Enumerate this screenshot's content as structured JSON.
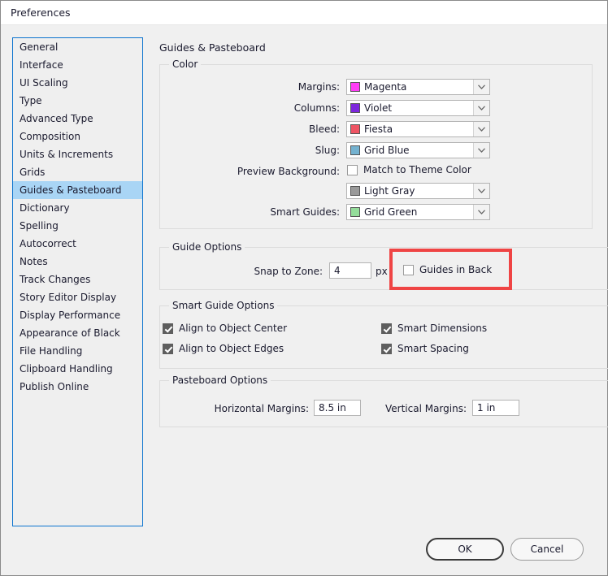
{
  "window": {
    "title": "Preferences"
  },
  "sidebar": {
    "selected": "Guides & Pasteboard",
    "items": [
      {
        "label": "General"
      },
      {
        "label": "Interface"
      },
      {
        "label": "UI Scaling"
      },
      {
        "label": "Type"
      },
      {
        "label": "Advanced Type"
      },
      {
        "label": "Composition"
      },
      {
        "label": "Units & Increments"
      },
      {
        "label": "Grids"
      },
      {
        "label": "Guides & Pasteboard"
      },
      {
        "label": "Dictionary"
      },
      {
        "label": "Spelling"
      },
      {
        "label": "Autocorrect"
      },
      {
        "label": "Notes"
      },
      {
        "label": "Track Changes"
      },
      {
        "label": "Story Editor Display"
      },
      {
        "label": "Display Performance"
      },
      {
        "label": "Appearance of Black"
      },
      {
        "label": "File Handling"
      },
      {
        "label": "Clipboard Handling"
      },
      {
        "label": "Publish Online"
      }
    ]
  },
  "pane": {
    "title": "Guides & Pasteboard"
  },
  "color_group": {
    "legend": "Color",
    "rows": [
      {
        "label": "Margins:",
        "value": "Magenta",
        "swatch": "#ff3df5"
      },
      {
        "label": "Columns:",
        "value": "Violet",
        "swatch": "#7d28dd"
      },
      {
        "label": "Bleed:",
        "value": "Fiesta",
        "swatch": "#ef5564"
      },
      {
        "label": "Slug:",
        "value": "Grid Blue",
        "swatch": "#74b2d0"
      }
    ],
    "preview_background": {
      "label": "Preview Background:",
      "checkbox_label": "Match to Theme Color",
      "checked": false,
      "value": "Light Gray",
      "swatch": "#9a9a9a"
    },
    "smart_guides": {
      "label": "Smart Guides:",
      "value": "Grid Green",
      "swatch": "#94dd9a"
    }
  },
  "guide_options": {
    "legend": "Guide Options",
    "snap_label": "Snap to Zone:",
    "snap_value": "4",
    "snap_unit": "px",
    "guides_in_back_label": "Guides in Back",
    "guides_in_back_checked": false,
    "highlight_color": "#ef4444"
  },
  "smart_guide_options": {
    "legend": "Smart Guide Options",
    "items": [
      {
        "label": "Align to Object Center",
        "checked": true
      },
      {
        "label": "Align to Object Edges",
        "checked": true
      },
      {
        "label": "Smart Dimensions",
        "checked": true
      },
      {
        "label": "Smart Spacing",
        "checked": true
      }
    ]
  },
  "pasteboard_options": {
    "legend": "Pasteboard Options",
    "horizontal_label": "Horizontal Margins:",
    "horizontal_value": "8.5 in",
    "vertical_label": "Vertical Margins:",
    "vertical_value": "1 in"
  },
  "footer": {
    "ok_label": "OK",
    "cancel_label": "Cancel"
  }
}
